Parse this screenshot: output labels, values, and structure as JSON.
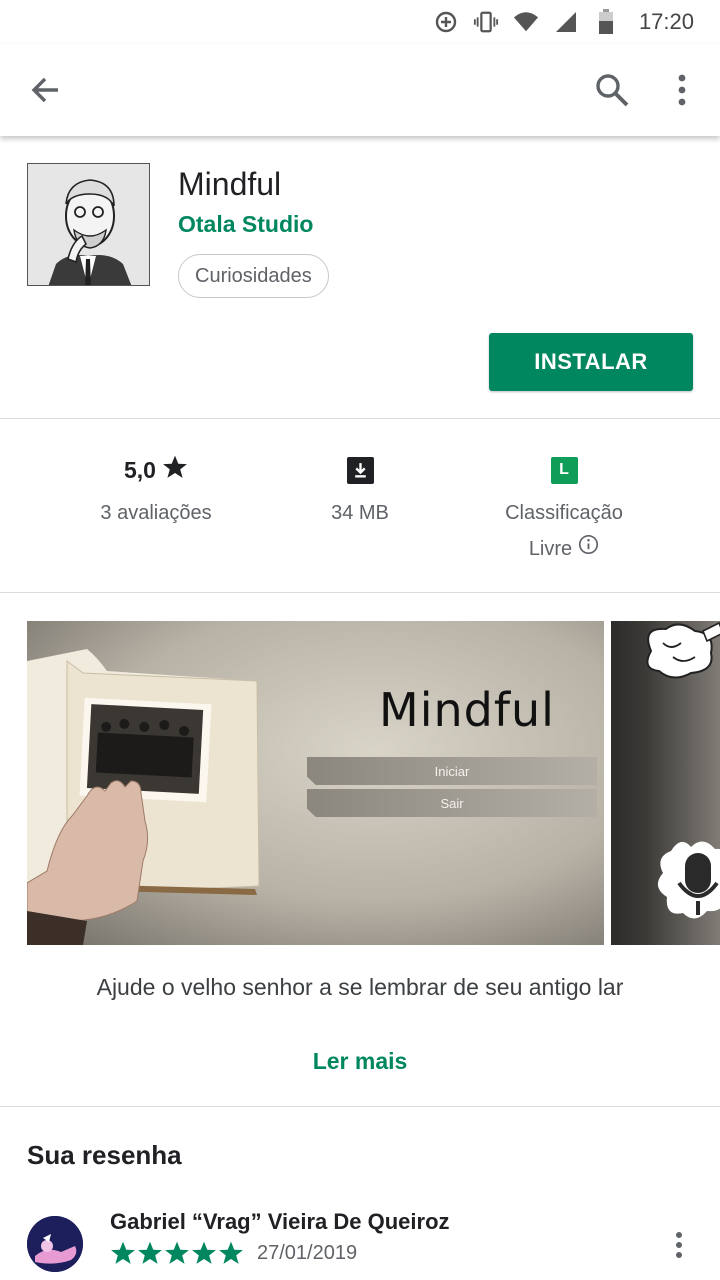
{
  "status_bar": {
    "time": "17:20"
  },
  "app": {
    "title": "Mindful",
    "developer": "Otala Studio",
    "category": "Curiosidades",
    "install_label": "INSTALAR"
  },
  "stats": {
    "rating_value": "5,0",
    "rating_count": "3 avaliações",
    "size": "34 MB",
    "content_rating_badge": "L",
    "content_rating_line1": "Classificação",
    "content_rating_line2": "Livre"
  },
  "screenshot": {
    "game_title": "Mindful",
    "menu_start": "Iniciar",
    "menu_exit": "Sair"
  },
  "description": "Ajude o velho senhor a se lembrar de seu antigo lar",
  "read_more": "Ler mais",
  "review_section": {
    "title": "Sua resenha",
    "reviewer": "Gabriel “Vrag” Vieira De Queiroz",
    "stars": 5,
    "date": "27/01/2019"
  },
  "colors": {
    "accent": "#01875f",
    "rating_badge": "#0f9d58"
  },
  "icons": [
    "add-circle-icon",
    "vibrate-icon",
    "wifi-icon",
    "signal-icon",
    "battery-icon",
    "back-arrow-icon",
    "search-icon",
    "more-vert-icon",
    "star-icon",
    "download-icon",
    "info-icon"
  ]
}
